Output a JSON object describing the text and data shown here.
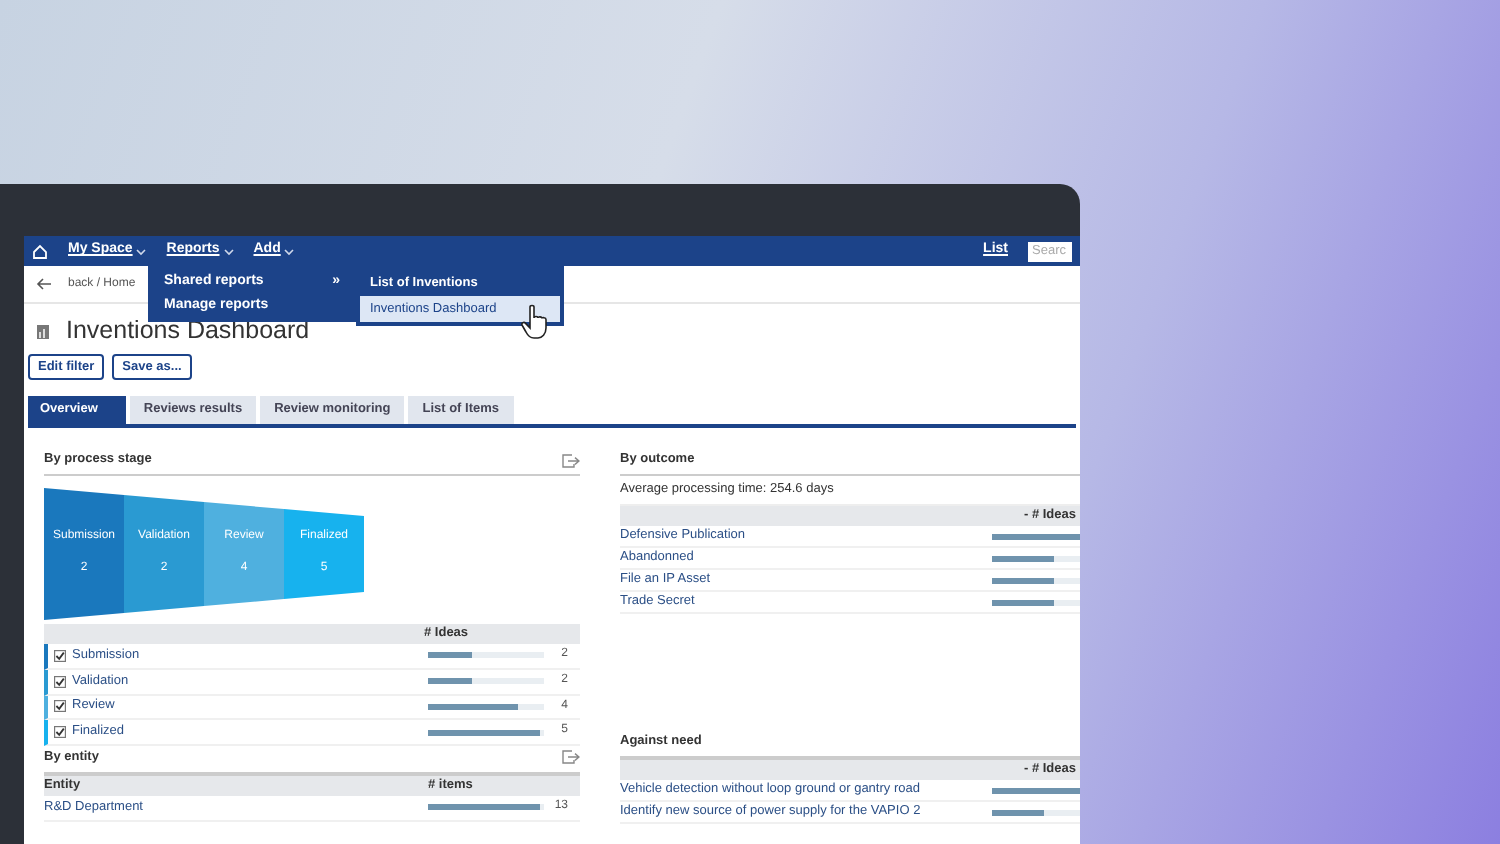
{
  "nav": {
    "items": [
      {
        "label": "My Space"
      },
      {
        "label": "Reports"
      },
      {
        "label": "Add"
      }
    ],
    "right_link": "List",
    "search": {
      "placeholder": "Searc"
    }
  },
  "reports_menu": {
    "items": [
      {
        "label": "Shared reports",
        "marker": "»"
      },
      {
        "label": "Manage reports"
      }
    ],
    "submenu": [
      {
        "label": "List of Inventions",
        "selected": false
      },
      {
        "label": "Inventions Dashboard",
        "selected": true
      }
    ]
  },
  "breadcrumb": "back / Home",
  "page_title": "Inventions Dashboard",
  "buttons": [
    "Edit filter",
    "Save as..."
  ],
  "tabs": [
    {
      "label": "Overview",
      "selected": true
    },
    {
      "label": "Reviews results",
      "selected": false
    },
    {
      "label": "Review monitoring",
      "selected": false
    },
    {
      "label": "List of Items",
      "selected": false
    }
  ],
  "process_stage": {
    "title": "By process stage",
    "stages": [
      {
        "label": "Submission",
        "value": "2",
        "color": "#1a78bd"
      },
      {
        "label": "Validation",
        "value": "2",
        "color": "#2a9ad2"
      },
      {
        "label": "Review",
        "value": "4",
        "color": "#4fb0df"
      },
      {
        "label": "Finalized",
        "value": "5",
        "color": "#17b2ee"
      }
    ],
    "column": "# Ideas",
    "rows": [
      {
        "label": "Submission",
        "checked": true,
        "level": 0.38,
        "count": "2"
      },
      {
        "label": "Validation",
        "checked": true,
        "level": 0.38,
        "count": "2"
      },
      {
        "label": "Review",
        "checked": true,
        "level": 0.77,
        "count": "4"
      },
      {
        "label": "Finalized",
        "checked": true,
        "level": 0.96,
        "count": "5"
      }
    ]
  },
  "entity": {
    "title": "By entity",
    "columns": [
      "Entity",
      "# items"
    ],
    "rows": [
      {
        "label": "R&D Department",
        "level": 0.96,
        "count": "13"
      }
    ]
  },
  "outcome": {
    "title": "By outcome",
    "average": "Average processing time: 254.6 days",
    "column": "- # Ideas",
    "rows": [
      {
        "label": "Defensive Publication",
        "level": 1
      },
      {
        "label": "Abandonned",
        "level": 0.7
      },
      {
        "label": "File an IP Asset",
        "level": 0.7
      },
      {
        "label": "Trade Secret",
        "level": 0.7
      }
    ]
  },
  "against_need": {
    "title": "Against need",
    "column": "- # Ideas",
    "rows": [
      {
        "label": "Vehicle detection without loop ground or gantry road",
        "level": 1
      },
      {
        "label": "Identify new source of power supply for the VAPIO 2",
        "level": 0.6
      }
    ]
  }
}
